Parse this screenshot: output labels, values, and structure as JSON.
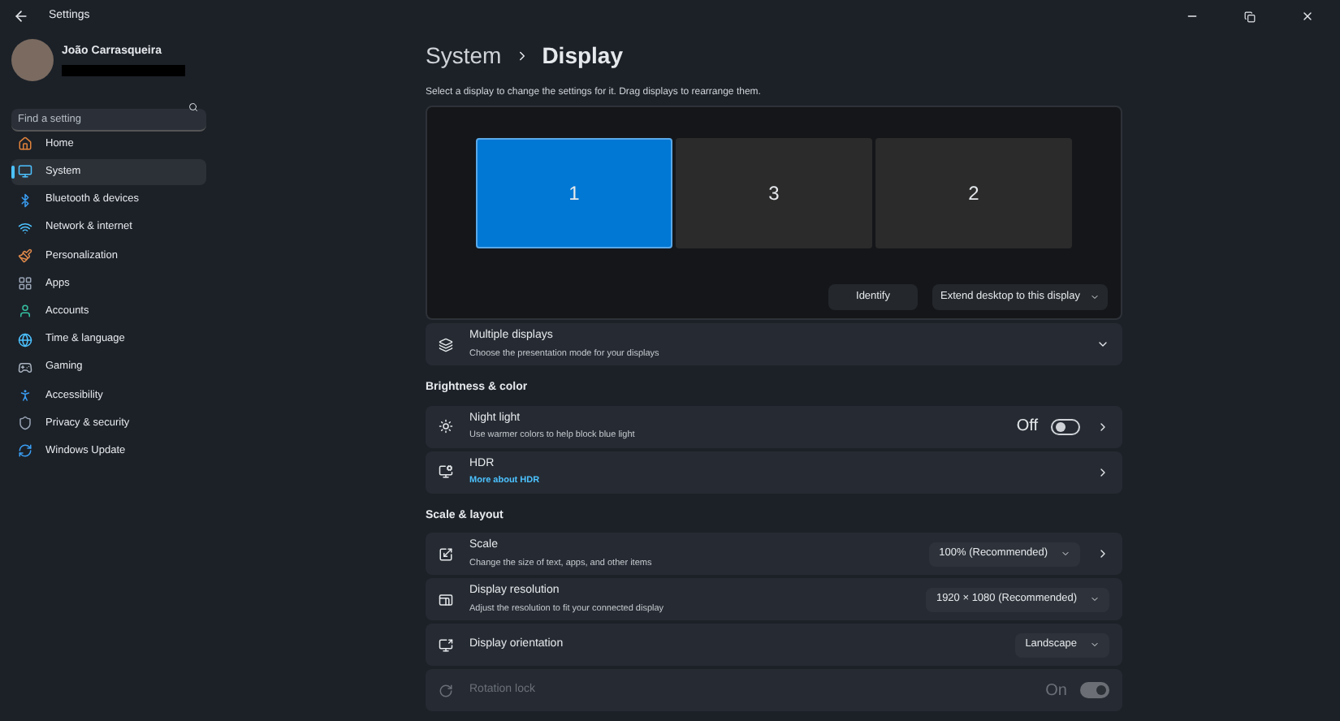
{
  "window": {
    "title": "Settings"
  },
  "user": {
    "name": "João Carrasqueira"
  },
  "search": {
    "placeholder": "Find a setting"
  },
  "nav": [
    {
      "label": "Home",
      "selected": false
    },
    {
      "label": "System",
      "selected": true
    },
    {
      "label": "Bluetooth & devices",
      "selected": false
    },
    {
      "label": "Network & internet",
      "selected": false
    },
    {
      "label": "Personalization",
      "selected": false
    },
    {
      "label": "Apps",
      "selected": false
    },
    {
      "label": "Accounts",
      "selected": false
    },
    {
      "label": "Time & language",
      "selected": false
    },
    {
      "label": "Gaming",
      "selected": false
    },
    {
      "label": "Accessibility",
      "selected": false
    },
    {
      "label": "Privacy & security",
      "selected": false
    },
    {
      "label": "Windows Update",
      "selected": false
    }
  ],
  "breadcrumb": {
    "parent": "System",
    "current": "Display"
  },
  "instructions": "Select a display to change the settings for it. Drag displays to rearrange them.",
  "displays": [
    {
      "label": "1",
      "selected": true
    },
    {
      "label": "3",
      "selected": false
    },
    {
      "label": "2",
      "selected": false
    }
  ],
  "identify_button": "Identify",
  "mode_dropdown": "Extend desktop to this display",
  "sections": [
    {
      "rows": [
        {
          "title": "Multiple displays",
          "subtitle": "Choose the presentation mode for your displays",
          "expand": true,
          "disabled": false
        }
      ]
    },
    {
      "title": "Brightness & color",
      "rows": [
        {
          "title": "Night light",
          "subtitle": "Use warmer colors to help block blue light",
          "toggle": {
            "label": "Off",
            "on": false
          },
          "chevron": true,
          "disabled": false
        },
        {
          "title": "HDR",
          "link": "More about HDR",
          "chevron": true,
          "disabled": false
        }
      ]
    },
    {
      "title": "Scale & layout",
      "rows": [
        {
          "title": "Scale",
          "subtitle": "Change the size of text, apps, and other items",
          "dropdown": "100% (Recommended)",
          "chevron": true,
          "disabled": false
        },
        {
          "title": "Display resolution",
          "subtitle": "Adjust the resolution to fit your connected display",
          "dropdown": "1920 × 1080 (Recommended)",
          "disabled": false
        },
        {
          "title": "Display orientation",
          "dropdown": "Landscape",
          "disabled": false
        },
        {
          "title": "Rotation lock",
          "toggle": {
            "label": "On",
            "on": true
          },
          "disabled": true
        }
      ]
    }
  ]
}
